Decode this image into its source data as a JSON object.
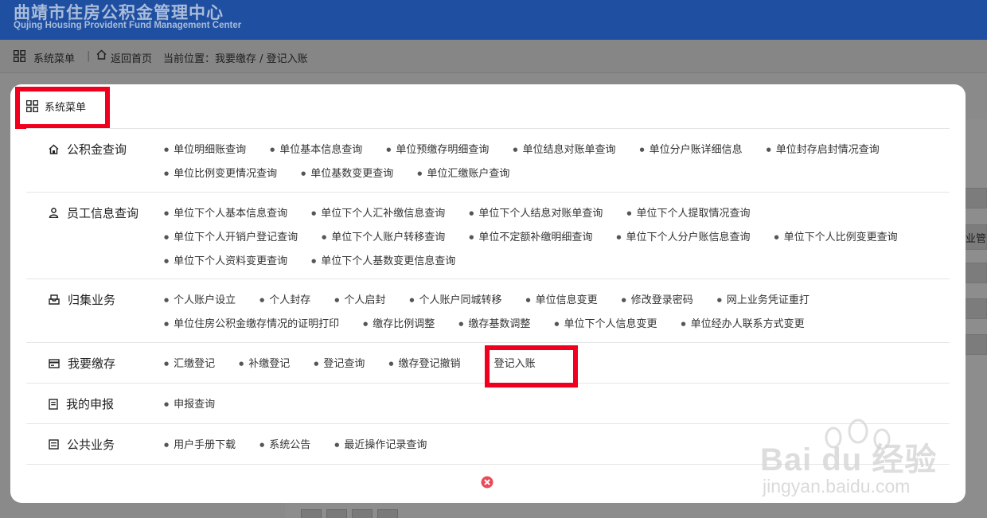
{
  "header": {
    "title": "曲靖市住房公积金管理中心",
    "subtitle": "Qujing Housing Provident Fund Management Center"
  },
  "topbar": {
    "menu_label": "系统菜单",
    "home_label": "返回首页",
    "location_label": "当前位置：我要缴存 / 登记入账"
  },
  "background": {
    "side_text": "业管"
  },
  "modal": {
    "title": "系统菜单",
    "sections": [
      {
        "title": "公积金查询",
        "icon": "home-icon",
        "links": [
          "单位明细账查询",
          "单位基本信息查询",
          "单位预缴存明细查询",
          "单位结息对账单查询",
          "单位分户账详细信息",
          "单位封存启封情况查询",
          "单位比例变更情况查询",
          "单位基数变更查询",
          "单位汇缴账户查询"
        ]
      },
      {
        "title": "员工信息查询",
        "icon": "user-icon",
        "links": [
          "单位下个人基本信息查询",
          "单位下个人汇补缴信息查询",
          "单位下个人结息对账单查询",
          "单位下个人提取情况查询",
          "单位下个人开销户登记查询",
          "单位下个人账户转移查询",
          "单位不定额补缴明细查询",
          "单位下个人分户账信息查询",
          "单位下个人比例变更查询",
          "单位下个人资料变更查询",
          "单位下个人基数变更信息查询"
        ]
      },
      {
        "title": "归集业务",
        "icon": "inbox-icon",
        "links": [
          "个人账户设立",
          "个人封存",
          "个人启封",
          "个人账户同城转移",
          "单位信息变更",
          "修改登录密码",
          "网上业务凭证重打",
          "单位住房公积金缴存情况的证明打印",
          "缴存比例调整",
          "缴存基数调整",
          "单位下个人信息变更",
          "单位经办人联系方式变更"
        ]
      },
      {
        "title": "我要缴存",
        "icon": "card-icon",
        "links": [
          "汇缴登记",
          "补缴登记",
          "登记查询",
          "缴存登记撤销",
          "登记入账"
        ]
      },
      {
        "title": "我的申报",
        "icon": "document-icon",
        "links": [
          "申报查询"
        ]
      },
      {
        "title": "公共业务",
        "icon": "list-icon",
        "links": [
          "用户手册下载",
          "系统公告",
          "最近操作记录查询"
        ]
      }
    ]
  },
  "watermark": {
    "brand": "Bai du 经验",
    "url": "jingyan.baidu.com"
  },
  "colors": {
    "header_bg": "#1f4fa0",
    "highlight": "#f0001e",
    "overlay": "#8a8a8a",
    "close": "#e94b5a"
  }
}
